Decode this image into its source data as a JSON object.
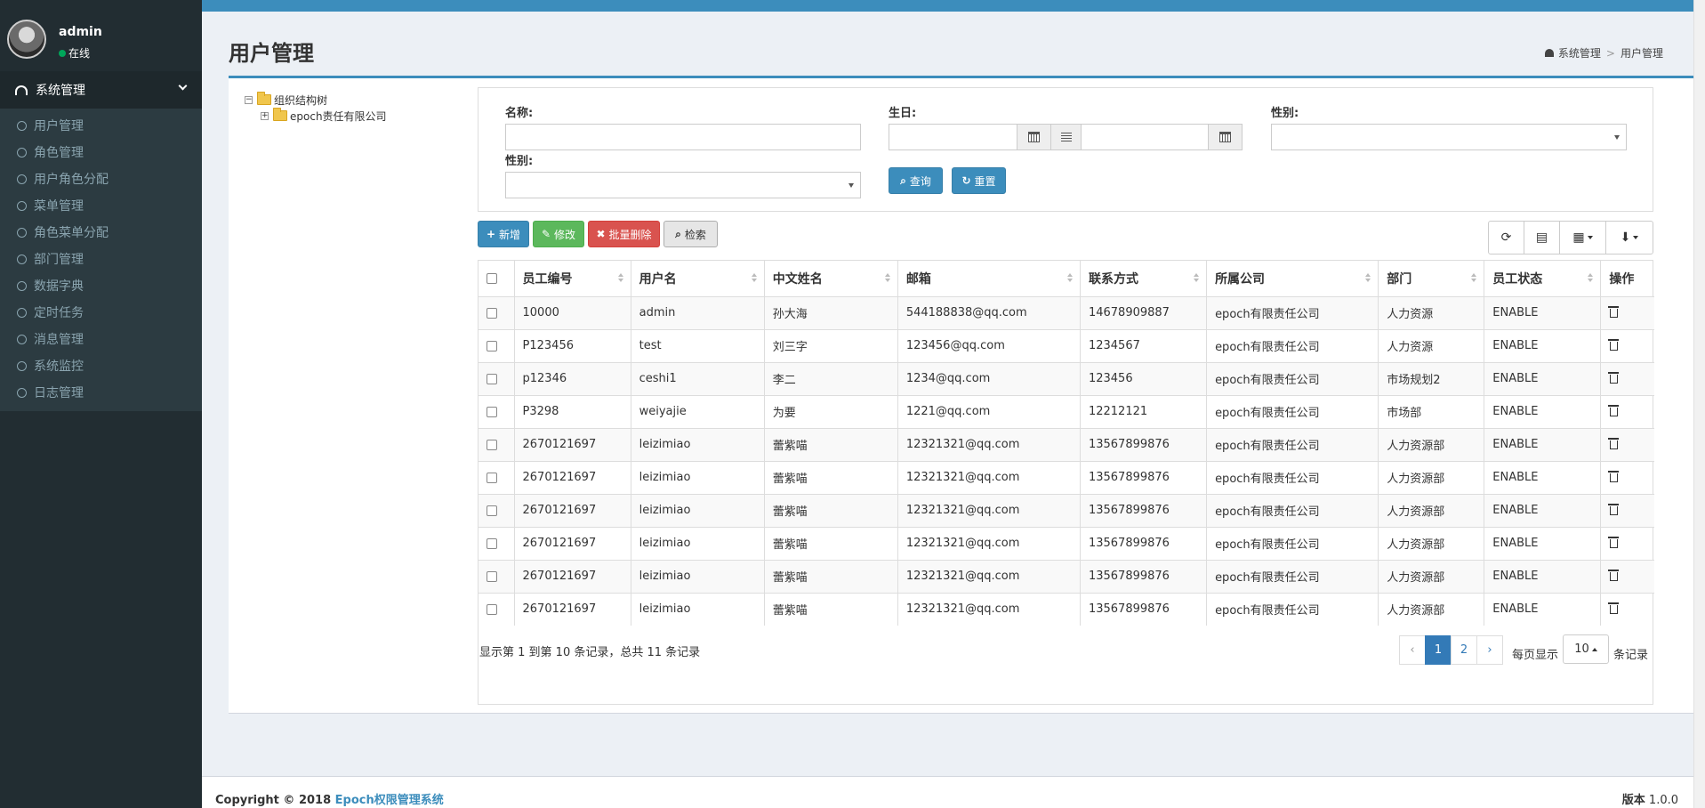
{
  "user": {
    "name": "admin",
    "status": "在线"
  },
  "sidebar": {
    "header_label": "系统管理",
    "items": [
      {
        "label": "用户管理"
      },
      {
        "label": "角色管理"
      },
      {
        "label": "用户角色分配"
      },
      {
        "label": "菜单管理"
      },
      {
        "label": "角色菜单分配"
      },
      {
        "label": "部门管理"
      },
      {
        "label": "数据字典"
      },
      {
        "label": "定时任务"
      },
      {
        "label": "消息管理"
      },
      {
        "label": "系统监控"
      },
      {
        "label": "日志管理"
      }
    ]
  },
  "page": {
    "title": "用户管理"
  },
  "breadcrumb": {
    "home": "系统管理",
    "current": "用户管理"
  },
  "tree": {
    "root": "组织结构树",
    "child": "epoch责任有限公司",
    "root_toggle": "−",
    "child_toggle": "+"
  },
  "search": {
    "name_label": "名称:",
    "birthday_label": "生日:",
    "gender_label_1": "性别:",
    "gender_label_2": "性别:",
    "name_value": "",
    "birthday_from": "",
    "birthday_to": "",
    "gender_1_value": "",
    "gender_2_value": "",
    "query_label": "查询",
    "reset_label": "重置"
  },
  "actions": {
    "add": "新增",
    "edit": "修改",
    "batch_delete": "批量删除",
    "search": "检索"
  },
  "table": {
    "columns": [
      "员工编号",
      "用户名",
      "中文姓名",
      "邮箱",
      "联系方式",
      "所属公司",
      "部门",
      "员工状态",
      "操作"
    ],
    "rows": [
      [
        "10000",
        "admin",
        "孙大海",
        "544188838@qq.com",
        "14678909887",
        "epoch有限责任公司",
        "人力资源",
        "ENABLE"
      ],
      [
        "P123456",
        "test",
        "刘三字",
        "123456@qq.com",
        "1234567",
        "epoch有限责任公司",
        "人力资源",
        "ENABLE"
      ],
      [
        "p12346",
        "ceshi1",
        "李二",
        "1234@qq.com",
        "123456",
        "epoch有限责任公司",
        "市场规划2",
        "ENABLE"
      ],
      [
        "P3298",
        "weiyajie",
        "为要",
        "1221@qq.com",
        "12212121",
        "epoch有限责任公司",
        "市场部",
        "ENABLE"
      ],
      [
        "2670121697",
        "leizimiao",
        "蕾紫喵",
        "12321321@qq.com",
        "13567899876",
        "epoch有限责任公司",
        "人力资源部",
        "ENABLE"
      ],
      [
        "2670121697",
        "leizimiao",
        "蕾紫喵",
        "12321321@qq.com",
        "13567899876",
        "epoch有限责任公司",
        "人力资源部",
        "ENABLE"
      ],
      [
        "2670121697",
        "leizimiao",
        "蕾紫喵",
        "12321321@qq.com",
        "13567899876",
        "epoch有限责任公司",
        "人力资源部",
        "ENABLE"
      ],
      [
        "2670121697",
        "leizimiao",
        "蕾紫喵",
        "12321321@qq.com",
        "13567899876",
        "epoch有限责任公司",
        "人力资源部",
        "ENABLE"
      ],
      [
        "2670121697",
        "leizimiao",
        "蕾紫喵",
        "12321321@qq.com",
        "13567899876",
        "epoch有限责任公司",
        "人力资源部",
        "ENABLE"
      ],
      [
        "2670121697",
        "leizimiao",
        "蕾紫喵",
        "12321321@qq.com",
        "13567899876",
        "epoch有限责任公司",
        "人力资源部",
        "ENABLE"
      ]
    ]
  },
  "pagination": {
    "info": "显示第 1 到第 10 条记录，总共 11 条记录",
    "prev": "‹",
    "pages": [
      "1",
      "2"
    ],
    "next": "›",
    "per_page_prefix": "每页显示",
    "per_page_value": "10",
    "per_page_suffix": "条记录"
  },
  "footer": {
    "copyright_prefix": "Copyright © 2018 ",
    "system_name": "Epoch权限管理系统",
    "version_label": "版本",
    "version_value": "1.0.0"
  },
  "colors": {
    "primary": "#3c8dbc",
    "sidebar": "#222d32",
    "success": "#5cb85c",
    "danger": "#d9534f"
  }
}
